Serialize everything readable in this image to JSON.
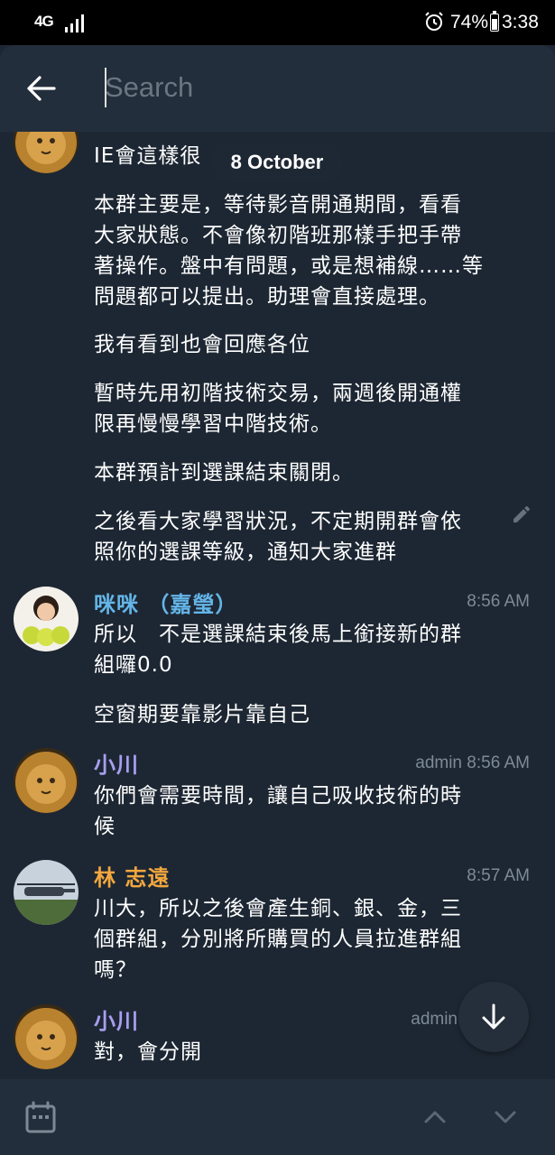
{
  "status_bar": {
    "network": "4G",
    "battery_percent": "74%",
    "battery_level": 0.74,
    "time": "3:38"
  },
  "search": {
    "placeholder": "Search",
    "value": ""
  },
  "chat": {
    "date_separator": "8 October",
    "messages": [
      {
        "sender": "",
        "time": "",
        "paragraphs": [
          "IE會這樣很",
          "本群主要是，等待影音開通期間，看看\n大家狀態。不會像初階班那樣手把手帶\n著操作。盤中有問題，或是想補線……等\n問題都可以提出。助理會直接處理。",
          "我有看到也會回應各位",
          "暫時先用初階技術交易，兩週後開通權\n限再慢慢學習中階技術。",
          "本群預計到選課結束關閉。",
          "之後看大家學習狀況，不定期開群會依\n照你的選課等級，通知大家進群"
        ]
      },
      {
        "sender": "咪咪 （嘉瑩）",
        "sender_color": "#64b5e8",
        "time": "8:56 AM",
        "paragraphs": [
          "所以　不是選課結束後馬上銜接新的群\n組囉0.0",
          "空窗期要靠影片靠自己"
        ]
      },
      {
        "sender": "小川",
        "sender_color": "#a99ef0",
        "time": "admin 8:56 AM",
        "paragraphs": [
          "你們會需要時間，讓自己吸收技術的時\n候"
        ]
      },
      {
        "sender": "林 志遠",
        "sender_color": "#f3a73e",
        "time": "8:57 AM",
        "paragraphs": [
          "川大，所以之後會產生銅、銀、金，三\n個群組，分別將所購買的人員拉進群組\n嗎？"
        ]
      },
      {
        "sender": "小川",
        "sender_color": "#a99ef0",
        "time": "admin",
        "paragraphs": [
          "對，會分開"
        ]
      }
    ]
  },
  "icons": {
    "back": "arrow-left-icon",
    "edit": "pencil-icon",
    "scroll_down": "arrow-down-icon",
    "calendar": "calendar-icon",
    "prev": "chevron-up-icon",
    "next": "chevron-down-icon"
  },
  "colors": {
    "background": "#1d2733",
    "header": "#232e3c",
    "secondary_text": "#7e8a97"
  }
}
